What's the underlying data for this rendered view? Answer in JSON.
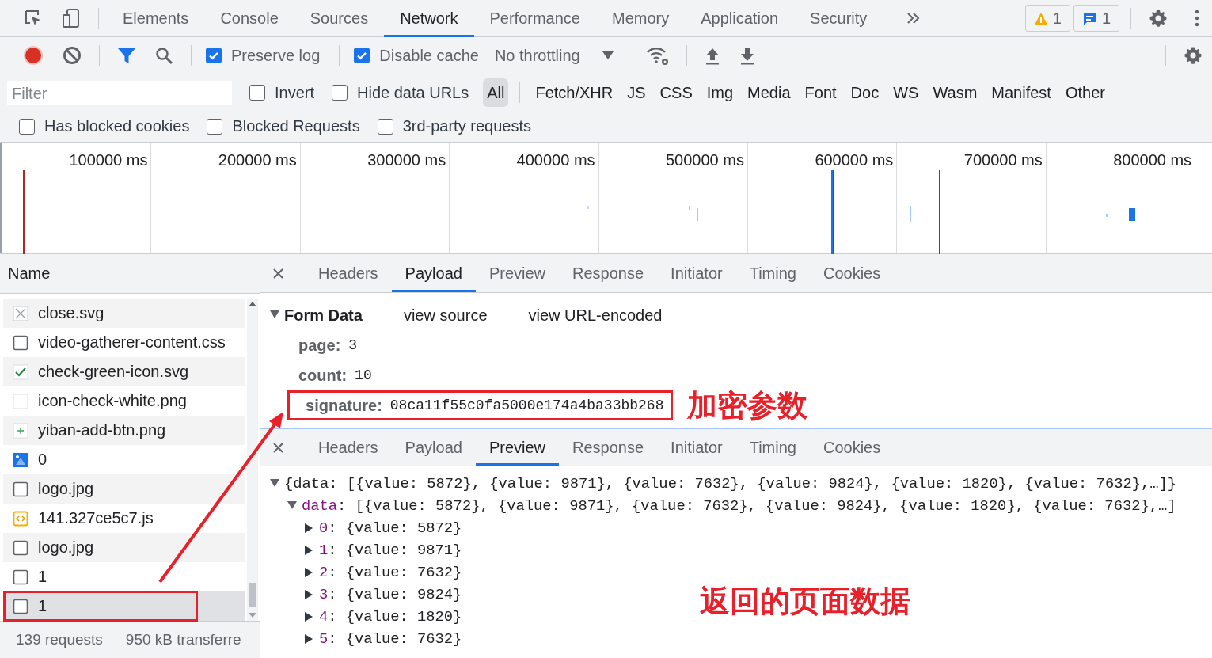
{
  "main_tabs": [
    {
      "label": "Elements",
      "selected": false
    },
    {
      "label": "Console",
      "selected": false
    },
    {
      "label": "Sources",
      "selected": false
    },
    {
      "label": "Network",
      "selected": true
    },
    {
      "label": "Performance",
      "selected": false
    },
    {
      "label": "Memory",
      "selected": false
    },
    {
      "label": "Application",
      "selected": false
    },
    {
      "label": "Security",
      "selected": false
    }
  ],
  "badges": [
    {
      "kind": "warning",
      "count": "1"
    },
    {
      "kind": "message",
      "count": "1"
    }
  ],
  "toolbar": {
    "recording": true,
    "options": [
      {
        "label": "Preserve log",
        "checked": true
      },
      {
        "label": "Disable cache",
        "checked": true
      }
    ],
    "throttling": "No throttling"
  },
  "filter": {
    "placeholder": "Filter",
    "options": [
      {
        "label": "Invert",
        "checked": false
      },
      {
        "label": "Hide data URLs",
        "checked": false
      }
    ],
    "types": [
      {
        "label": "All",
        "selected": true
      },
      {
        "label": "Fetch/XHR",
        "selected": false
      },
      {
        "label": "JS",
        "selected": false
      },
      {
        "label": "CSS",
        "selected": false
      },
      {
        "label": "Img",
        "selected": false
      },
      {
        "label": "Media",
        "selected": false
      },
      {
        "label": "Font",
        "selected": false
      },
      {
        "label": "Doc",
        "selected": false
      },
      {
        "label": "WS",
        "selected": false
      },
      {
        "label": "Wasm",
        "selected": false
      },
      {
        "label": "Manifest",
        "selected": false
      },
      {
        "label": "Other",
        "selected": false
      }
    ],
    "more_options": [
      {
        "label": "Has blocked cookies",
        "checked": false
      },
      {
        "label": "Blocked Requests",
        "checked": false
      },
      {
        "label": "3rd-party requests",
        "checked": false
      }
    ]
  },
  "overview": {
    "ticks": [
      "100000 ms",
      "200000 ms",
      "300000 ms",
      "400000 ms",
      "500000 ms",
      "600000 ms",
      "700000 ms",
      "800000 ms"
    ]
  },
  "requests": {
    "header": "Name",
    "rows": [
      {
        "name": "close.svg",
        "kind": "close",
        "selected": false,
        "highlighted": false
      },
      {
        "name": "video-gatherer-content.css",
        "kind": "file",
        "selected": false,
        "highlighted": false
      },
      {
        "name": "check-green-icon.svg",
        "kind": "check",
        "selected": false,
        "highlighted": false
      },
      {
        "name": "icon-check-white.png",
        "kind": "blank",
        "selected": false,
        "highlighted": false
      },
      {
        "name": "yiban-add-btn.png",
        "kind": "plus",
        "selected": false,
        "highlighted": false
      },
      {
        "name": "0",
        "kind": "image",
        "selected": false,
        "highlighted": false
      },
      {
        "name": "logo.jpg",
        "kind": "file",
        "selected": false,
        "highlighted": false
      },
      {
        "name": "141.327ce5c7.js",
        "kind": "script",
        "selected": false,
        "highlighted": false
      },
      {
        "name": "logo.jpg",
        "kind": "file",
        "selected": false,
        "highlighted": false
      },
      {
        "name": "1",
        "kind": "file",
        "selected": false,
        "highlighted": false
      },
      {
        "name": "1",
        "kind": "file",
        "selected": true,
        "highlighted": true
      }
    ],
    "footer": [
      "139 requests",
      "950 kB transferre"
    ]
  },
  "payload_panel": {
    "tabs": [
      {
        "label": "Headers",
        "selected": false
      },
      {
        "label": "Payload",
        "selected": true
      },
      {
        "label": "Preview",
        "selected": false
      },
      {
        "label": "Response",
        "selected": false
      },
      {
        "label": "Initiator",
        "selected": false
      },
      {
        "label": "Timing",
        "selected": false
      },
      {
        "label": "Cookies",
        "selected": false
      }
    ],
    "section": {
      "title": "Form Data",
      "expanded": true,
      "links": [
        "view source",
        "view URL-encoded"
      ],
      "fields": [
        {
          "key": "page:",
          "value": "3",
          "highlighted": false
        },
        {
          "key": "count:",
          "value": "10",
          "highlighted": false
        },
        {
          "key": "_signature:",
          "value": "08ca11f55c0fa5000e174a4ba33bb268",
          "highlighted": true,
          "annotation": "加密参数"
        }
      ]
    }
  },
  "preview_panel": {
    "tabs": [
      {
        "label": "Headers",
        "selected": false
      },
      {
        "label": "Payload",
        "selected": false
      },
      {
        "label": "Preview",
        "selected": true
      },
      {
        "label": "Response",
        "selected": false
      },
      {
        "label": "Initiator",
        "selected": false
      },
      {
        "label": "Timing",
        "selected": false
      },
      {
        "label": "Cookies",
        "selected": false
      }
    ],
    "tree": {
      "value": "{data: [{value: 5872}, {value: 9871}, {value: 7632}, {value: 9824}, {value: 1820}, {value: 7632},…]}",
      "expanded": true,
      "children": [
        {
          "key": "data",
          "value": ": [{value: 5872}, {value: 9871}, {value: 7632}, {value: 9824}, {value: 1820}, {value: 7632},…]",
          "expanded": true,
          "children": [
            {
              "key": "0",
              "value": ": {value: 5872}",
              "expanded": false
            },
            {
              "key": "1",
              "value": ": {value: 9871}",
              "expanded": false
            },
            {
              "key": "2",
              "value": ": {value: 7632}",
              "expanded": false
            },
            {
              "key": "3",
              "value": ": {value: 9824}",
              "expanded": false
            },
            {
              "key": "4",
              "value": ": {value: 1820}",
              "expanded": false
            },
            {
              "key": "5",
              "value": ": {value: 7632}",
              "expanded": false
            }
          ]
        }
      ]
    },
    "annotation": "返回的页面数据"
  }
}
